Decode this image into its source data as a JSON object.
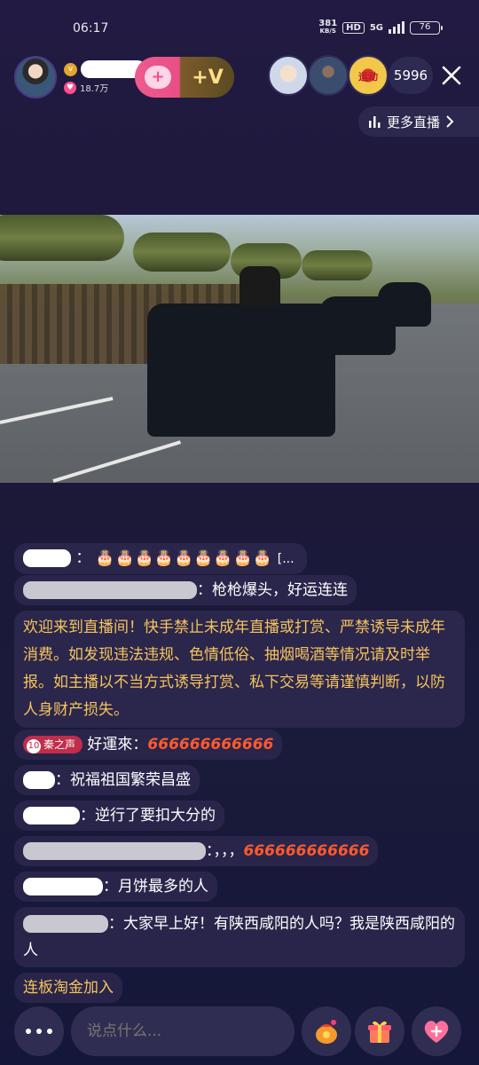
{
  "status_bar": {
    "time": "06:17",
    "net_speed_value": "381",
    "net_speed_unit": "KB/S",
    "hd": "HD",
    "network": "5G",
    "battery": "76"
  },
  "host": {
    "level_icon": "v",
    "fans": "18.7万"
  },
  "follow": {
    "heart_label": "+",
    "vip_label": "+V"
  },
  "viewers": {
    "count": "5996",
    "third_avatar_text": "运动"
  },
  "more_live": {
    "label": "更多直播",
    "icon": "bar-chart-icon"
  },
  "chat": {
    "msg1": {
      "tail": "[..."
    },
    "msg2": {
      "text": "：枪枪爆头，好运连连"
    },
    "notice": "欢迎来到直播间！快手禁止未成年直播或打赏、严禁诱导未成年消费。如发现违法违规、色情低俗、抽烟喝酒等情况请及时举报。如主播以不当方式诱导打赏、私下交易等请谨慎判断，以防人身财产损失。",
    "msg3": {
      "badge_level": "10",
      "badge_text": "秦之声",
      "text": "好運來：",
      "emoji": "666666666666"
    },
    "msg4": {
      "text": "：祝福祖国繁荣昌盛"
    },
    "msg5": {
      "text": "：逆行了要扣大分的"
    },
    "msg6": {
      "text": "：，，，",
      "emoji": "666666666666"
    },
    "msg7": {
      "text": "：月饼最多的人"
    },
    "msg8": {
      "text": "：大家早上好！有陕西咸阳的人吗？我是陕西咸阳的人"
    },
    "msg9": {
      "text": "连板淘金加入"
    }
  },
  "bottom_bar": {
    "input_placeholder": "说点什么...",
    "more_icon": "more-icon",
    "gift_bag_icon": "lucky-bag-icon",
    "gift_icon": "gift-icon",
    "like_icon": "heart-icon"
  }
}
